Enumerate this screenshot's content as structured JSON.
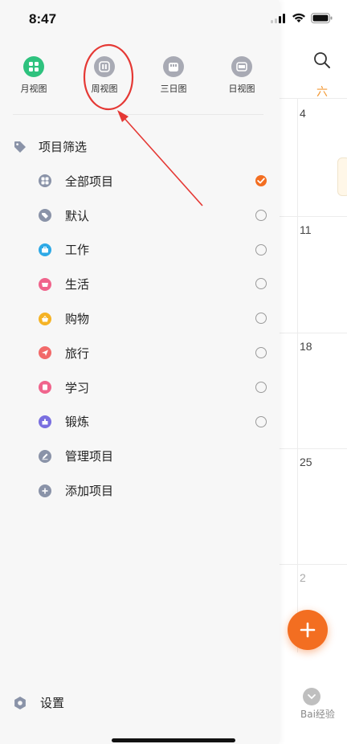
{
  "status_bar": {
    "time": "8:47"
  },
  "view_switcher": {
    "items": [
      {
        "label": "月视图",
        "icon": "month-grid-icon"
      },
      {
        "label": "周视图",
        "icon": "week-columns-icon"
      },
      {
        "label": "三日图",
        "icon": "three-day-icon"
      },
      {
        "label": "日视图",
        "icon": "day-view-icon"
      }
    ]
  },
  "filter": {
    "title": "项目筛选"
  },
  "projects": [
    {
      "label": "全部项目",
      "color": "#8a93a8",
      "icon": "grid-icon",
      "selected": true
    },
    {
      "label": "默认",
      "color": "#8a93a8",
      "icon": "tag-icon",
      "selected": false
    },
    {
      "label": "工作",
      "color": "#2ea9e6",
      "icon": "briefcase-icon",
      "selected": false
    },
    {
      "label": "生活",
      "color": "#f0648c",
      "icon": "cup-icon",
      "selected": false
    },
    {
      "label": "购物",
      "color": "#f5b325",
      "icon": "basket-icon",
      "selected": false
    },
    {
      "label": "旅行",
      "color": "#f26a6a",
      "icon": "plane-icon",
      "selected": false
    },
    {
      "label": "学习",
      "color": "#f0648c",
      "icon": "book-icon",
      "selected": false
    },
    {
      "label": "锻炼",
      "color": "#7a6fe0",
      "icon": "dumbbell-icon",
      "selected": false
    },
    {
      "label": "管理项目",
      "color": "#8a93a8",
      "icon": "edit-icon",
      "selected": null
    },
    {
      "label": "添加项目",
      "color": "#8a93a8",
      "icon": "plus-icon",
      "selected": null
    }
  ],
  "settings": {
    "label": "设置"
  },
  "calendar": {
    "weekday": "六",
    "dates": [
      "4",
      "11",
      "18",
      "25",
      "2"
    ]
  },
  "watermark": "Bai经验",
  "colors": {
    "accent": "#f36e21",
    "annotation": "#e53935",
    "weekday": "#f39a37"
  }
}
